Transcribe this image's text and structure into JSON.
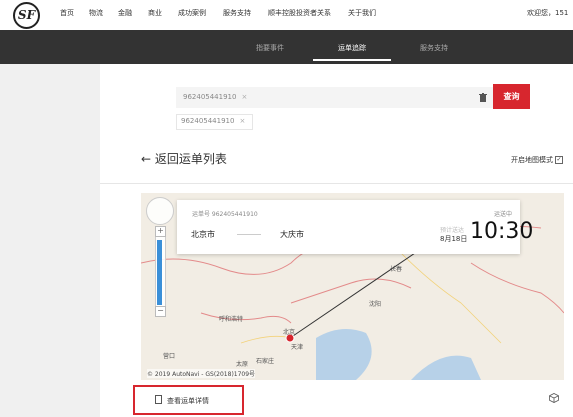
{
  "header": {
    "logo_text": "SF",
    "nav": [
      "首页",
      "物流",
      "金融",
      "商业",
      "成功案例",
      "服务支持",
      "顺丰控股投资者关系",
      "关于我们"
    ],
    "welcome": "欢迎您，151"
  },
  "subnav": {
    "items": [
      "指要事件",
      "运单追踪",
      "服务支持"
    ],
    "active": "运单追踪"
  },
  "search": {
    "tag_value": "962405441910",
    "history_tag": "962405441910",
    "button_label": "查询"
  },
  "page": {
    "back_label": "返回运单列表",
    "map_mode_label": "开启地图模式",
    "map_mode_checked": "✓"
  },
  "tracking_card": {
    "waybill_label": "运单号 962405441910",
    "origin": "北京市",
    "destination": "大庆市",
    "status": "运送中",
    "eta_label": "预计送达",
    "eta_date": "8月18日",
    "eta_time": "10:30"
  },
  "map": {
    "labels": {
      "changchun": "长春",
      "shenyang": "沈阳",
      "hohhot": "呼和浩特",
      "beijing": "北京",
      "tianjin": "天津",
      "shijiazhuang": "石家庄",
      "taiyuan": "太原",
      "yingkou": "营口"
    },
    "attribution": "© 2019 AutoNavi - GS(2018)1709号",
    "zoom_in": "+",
    "zoom_out": "−"
  },
  "detail_button": {
    "label": "查看运单详情"
  },
  "colors": {
    "brand_red": "#d7262e",
    "dark_bar": "#333333",
    "route": "#333333"
  }
}
